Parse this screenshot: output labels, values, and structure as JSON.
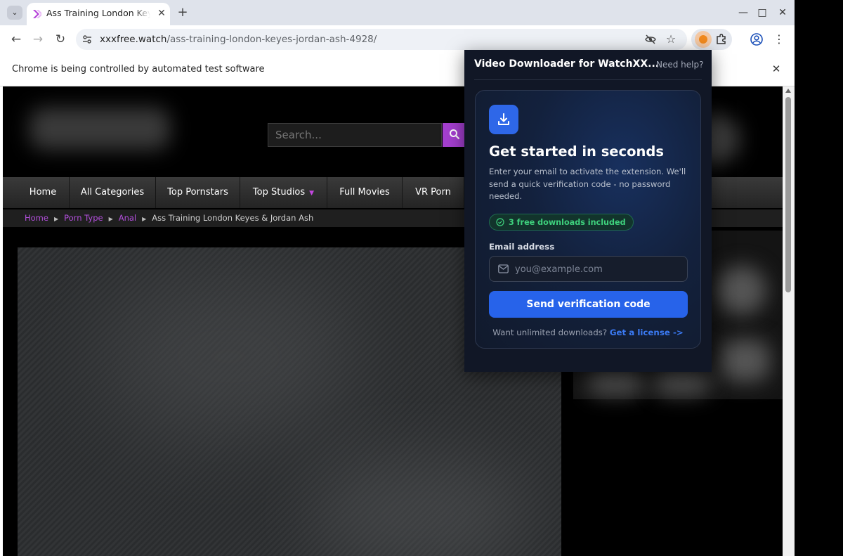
{
  "browser": {
    "tab_title": "Ass Training London Keyes & Jordan Ash",
    "tab_close": "✕",
    "new_tab": "+",
    "url_host": "xxxfree.watch",
    "url_path": "/ass-training-london-keyes-jordan-ash-4928/",
    "infobar_text": "Chrome is being controlled by automated test software",
    "icons": [
      "tab-dropdown-icon",
      "back-icon",
      "forward-icon",
      "reload-icon",
      "site-info-icon",
      "eye-off-icon",
      "star-icon",
      "extension-active-icon",
      "puzzle-icon",
      "profile-icon",
      "menu-icon",
      "minimize-icon",
      "maximize-icon",
      "close-icon"
    ]
  },
  "site": {
    "search_placeholder": "Search...",
    "nav": [
      "Home",
      "All Categories",
      "Top Pornstars",
      "Top Studios",
      "Full Movies",
      "VR Porn"
    ],
    "breadcrumb": {
      "links": [
        "Home",
        "Porn Type",
        "Anal"
      ],
      "current": "Ass Training London Keyes & Jordan Ash"
    },
    "accent_color": "#a53fd0"
  },
  "popup": {
    "title": "Video Downloader for WatchXX...",
    "help": "Need help?",
    "heading": "Get started in seconds",
    "description": "Enter your email to activate the extension. We'll send a quick verification code - no password needed.",
    "badge": "3 free downloads included",
    "email_label": "Email address",
    "email_placeholder": "you@example.com",
    "button": "Send verification code",
    "license_prompt": "Want unlimited downloads?",
    "license_link": "Get a license ->",
    "button_color": "#2763ea"
  }
}
